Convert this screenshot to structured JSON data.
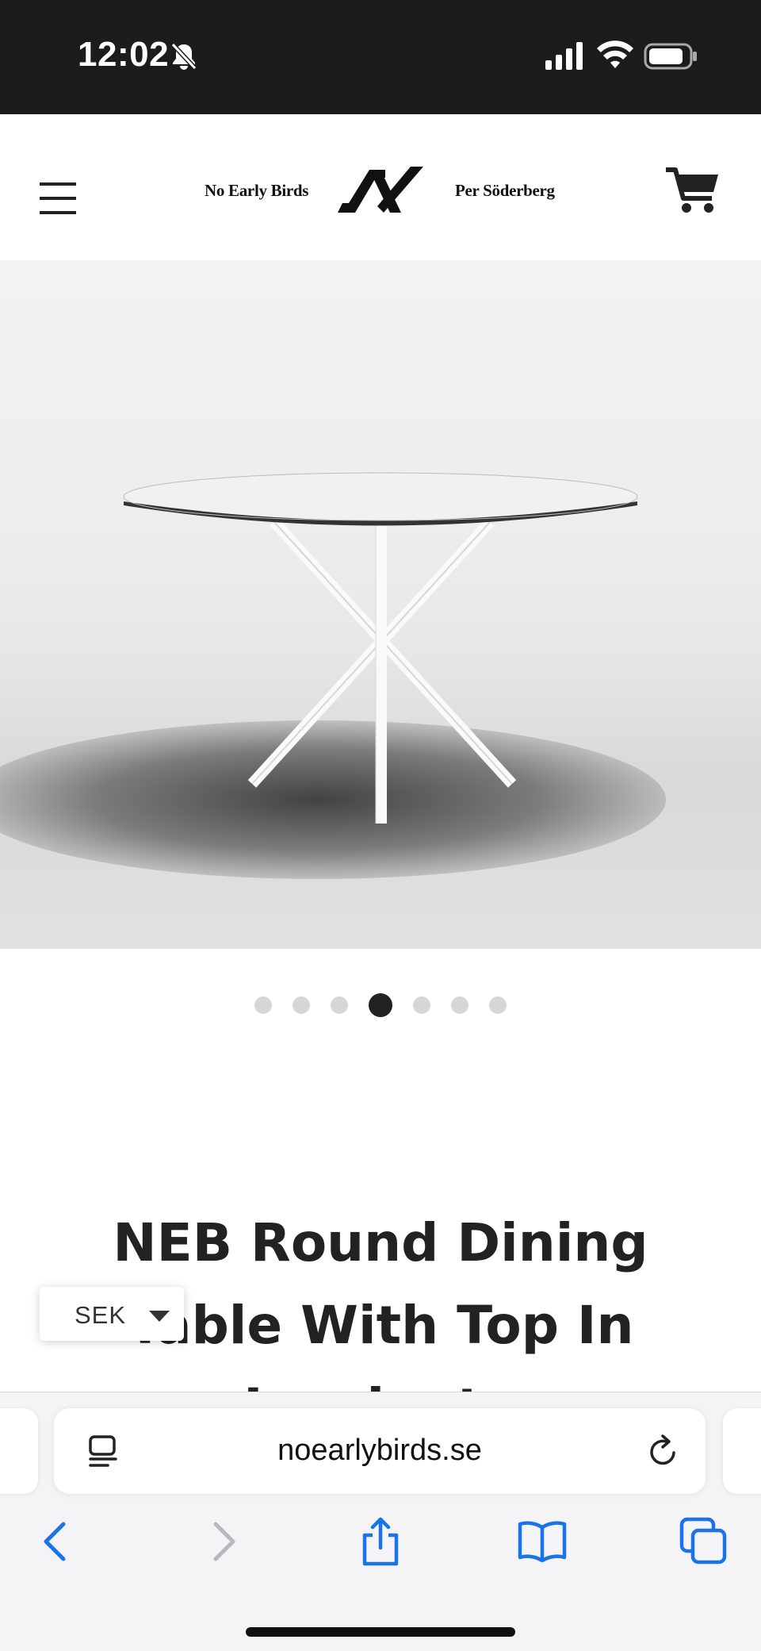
{
  "status_bar": {
    "time": "12:02",
    "icons": [
      "bell-slash-icon",
      "cellular-signal-icon",
      "wifi-icon",
      "battery-icon"
    ]
  },
  "header": {
    "brand_left": "No Early Birds",
    "brand_right": "Per Söderberg",
    "icons": [
      "hamburger-menu-icon",
      "nx-logo-icon",
      "cart-icon"
    ]
  },
  "gallery": {
    "dot_count": 7,
    "active_index": 3
  },
  "product": {
    "title_line1": "NEB Round Dining",
    "title_line2": "Table With Top In",
    "title_line3": "Laminate"
  },
  "currency": {
    "selected": "SEK"
  },
  "browser": {
    "url": "noearlybirds.se",
    "toolbar_icons": [
      "back-icon",
      "forward-icon",
      "share-icon",
      "bookmarks-icon",
      "tabs-icon"
    ]
  },
  "colors": {
    "status_bar_bg": "#1c1c1c",
    "text_dark": "#222222",
    "ios_blue": "#1a73e8",
    "dot_inactive": "#d6d6d6"
  }
}
